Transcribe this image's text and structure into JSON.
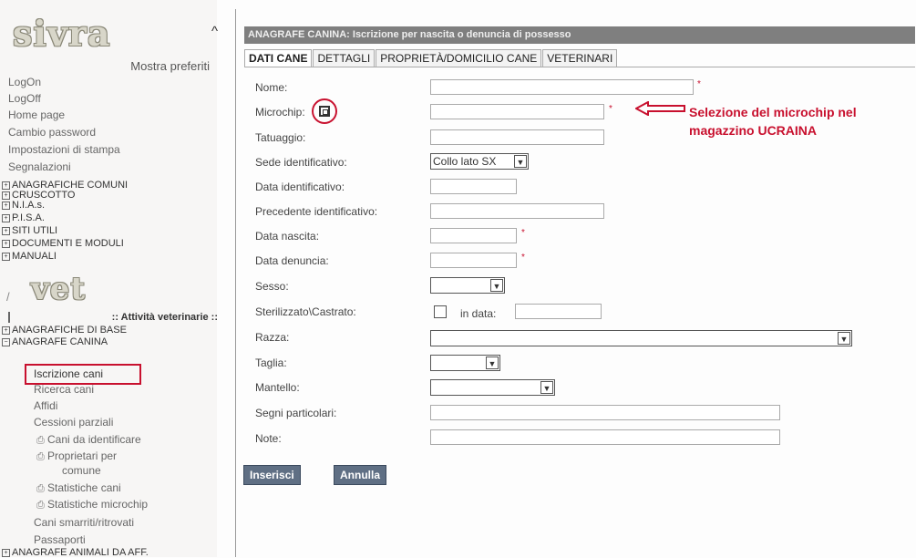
{
  "app": {
    "logo": "sivra",
    "logo_vet": "vet",
    "collapse_arrow": "^"
  },
  "sidebar": {
    "mostra_preferiti": "Mostra preferiti",
    "links": [
      "LogOn",
      "LogOff",
      "Home page",
      "Cambio password",
      "Impostazioni di stampa",
      "Segnalazioni"
    ],
    "categories": [
      "ANAGRAFICHE COMUNI",
      "CRUSCOTTO",
      "N.I.A.s.",
      "P.I.S.A.",
      "SITI UTILI",
      "DOCUMENTI E MODULI",
      "MANUALI"
    ],
    "vet_heading": ":: Attività veterinarie ::",
    "vet_categories": [
      "ANAGRAFICHE DI BASE",
      "ANAGRAFE CANINA"
    ],
    "anagrafe_items": [
      "Iscrizione cani",
      "Ricerca cani",
      "Affidi",
      "Cessioni parziali"
    ],
    "print_items": [
      "Cani da identificare",
      "Proprietari per",
      "comune",
      "Statistiche cani",
      "Statistiche microchip"
    ],
    "bottom_items": [
      "Cani smarriti/ritrovati",
      "Passaporti"
    ],
    "bottom_category": "ANAGRAFE ANIMALI DA AFF.",
    "expand_symbol": "+",
    "collapse_symbol": "−",
    "print_icon": "printer-icon"
  },
  "main": {
    "title": "ANAGRAFE CANINA: Iscrizione per nascita o denuncia di possesso",
    "tabs": [
      "DATI CANE",
      "DETTAGLI",
      "PROPRIETÀ/DOMICILIO CANE",
      "VETERINARI"
    ],
    "fields": {
      "nome": "Nome:",
      "microchip": "Microchip:",
      "tatuaggio": "Tatuaggio:",
      "sede": "Sede identificativo:",
      "sede_value": "Collo lato SX",
      "data_ident": "Data identificativo:",
      "prec_ident": "Precedente identificativo:",
      "data_nascita": "Data nascita:",
      "data_denuncia": "Data denuncia:",
      "sesso": "Sesso:",
      "sterilizzato": "Sterilizzato\\Castrato:",
      "in_data": "in data:",
      "razza": "Razza:",
      "taglia": "Taglia:",
      "mantello": "Mantello:",
      "segni": "Segni particolari:",
      "note": "Note:"
    },
    "required_mark": "*",
    "dropdown_arrow": "▼",
    "annotation": [
      "Selezione del microchip nel",
      "magazzino UCRAINA"
    ],
    "buttons": {
      "inserisci": "Inserisci",
      "annulla": "Annulla"
    }
  },
  "colors": {
    "accent_red": "#c8102e",
    "title_bar": "#7f7f7f",
    "button": "#5f6f84"
  }
}
